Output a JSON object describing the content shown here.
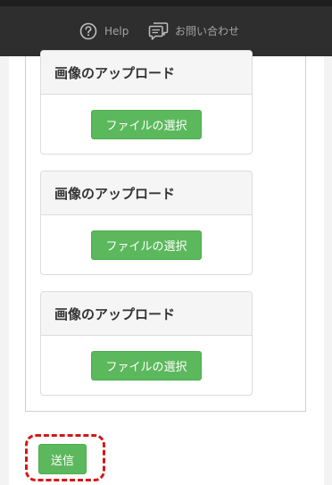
{
  "header": {
    "help_label": "Help",
    "help_icon": "question-circle-icon",
    "contact_label": "お問い合わせ",
    "contact_icon": "chat-bubbles-icon"
  },
  "uploads": [
    {
      "title": "画像のアップロード",
      "button_label": "ファイルの選択"
    },
    {
      "title": "画像のアップロード",
      "button_label": "ファイルの選択"
    },
    {
      "title": "画像のアップロード",
      "button_label": "ファイルの選択"
    }
  ],
  "form": {
    "submit_label": "送信"
  },
  "colors": {
    "header_bg": "#2e2e2e",
    "button_green": "#5cb85c",
    "highlight_red": "#d41818"
  }
}
